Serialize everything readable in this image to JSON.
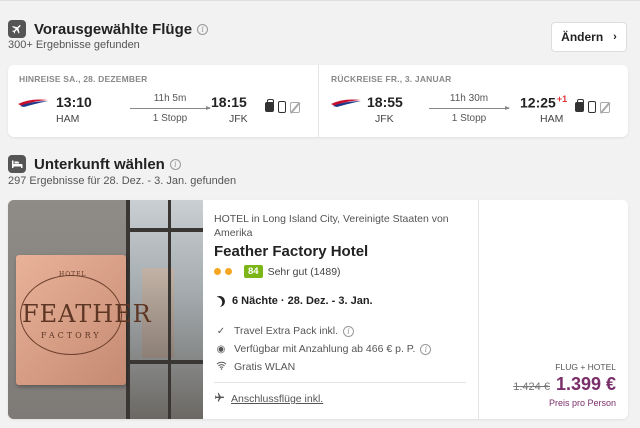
{
  "flights": {
    "title": "Vorausgewählte Flüge",
    "subtitle": "300+ Ergebnisse gefunden",
    "change_label": "Ändern",
    "outbound": {
      "label": "HINREISE SA., 28. DEZEMBER",
      "dep_time": "13:10",
      "dep_airport": "HAM",
      "duration": "11h 5m",
      "stops": "1 Stopp",
      "arr_time": "18:15",
      "arr_airport": "JFK",
      "day_offset": ""
    },
    "return": {
      "label": "RÜCKREISE FR., 3. JANUAR",
      "dep_time": "18:55",
      "dep_airport": "JFK",
      "duration": "11h 30m",
      "stops": "1 Stopp",
      "arr_time": "12:25",
      "arr_airport": "HAM",
      "day_offset": "+1"
    }
  },
  "accommodation": {
    "title": "Unterkunft wählen",
    "subtitle": "297 Ergebnisse für 28. Dez. - 3. Jan. gefunden"
  },
  "hotel": {
    "type_location": "HOTEL in Long Island City, Vereinigte Staaten von Amerika",
    "name": "Feather Factory Hotel",
    "stars": 2,
    "score": "84",
    "rating_text": "Sehr gut (1489)",
    "nights": "6 Nächte · 28. Dez. - 3. Jan.",
    "features": [
      "Travel Extra Pack inkl.",
      "Verfügbar mit Anzahlung ab 466 € p. P.",
      "Gratis WLAN"
    ],
    "connection": "Anschlussflüge inkl.",
    "photo_sign": {
      "top": "HOTEL",
      "main": "FEATHER",
      "bottom": "FACTORY"
    },
    "price_label": "FLUG + HOTEL",
    "old_price": "1.424 €",
    "new_price": "1.399 €",
    "per_person": "Preis pro Person"
  },
  "colors": {
    "accent_price": "#7a2e6a",
    "score_badge": "#7cb518",
    "star_dot": "#f5a623",
    "day_offset": "#dd3333"
  }
}
